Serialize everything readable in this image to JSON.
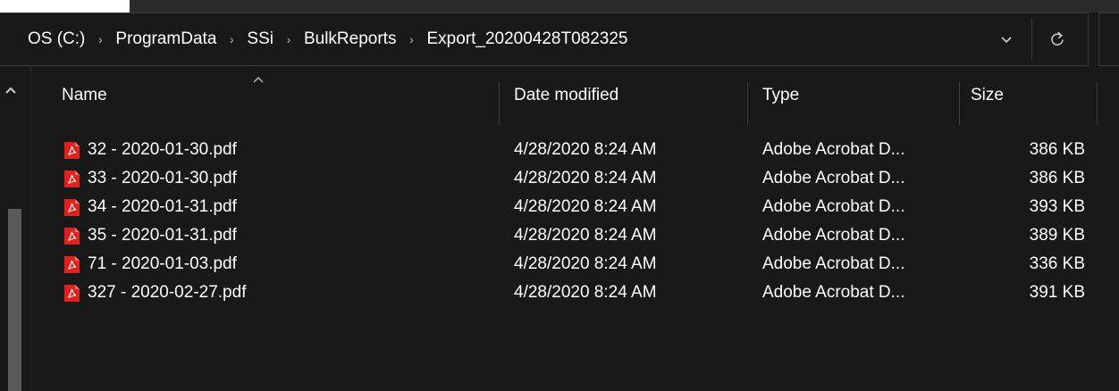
{
  "breadcrumb": {
    "items": [
      "OS (C:)",
      "ProgramData",
      "SSi",
      "BulkReports",
      "Export_20200428T082325"
    ]
  },
  "columns": {
    "name": "Name",
    "date": "Date modified",
    "type": "Type",
    "size": "Size"
  },
  "files": [
    {
      "name": "32 - 2020-01-30.pdf",
      "date": "4/28/2020 8:24 AM",
      "type": "Adobe Acrobat D...",
      "size": "386 KB"
    },
    {
      "name": "33 - 2020-01-30.pdf",
      "date": "4/28/2020 8:24 AM",
      "type": "Adobe Acrobat D...",
      "size": "386 KB"
    },
    {
      "name": "34 - 2020-01-31.pdf",
      "date": "4/28/2020 8:24 AM",
      "type": "Adobe Acrobat D...",
      "size": "393 KB"
    },
    {
      "name": "35 - 2020-01-31.pdf",
      "date": "4/28/2020 8:24 AM",
      "type": "Adobe Acrobat D...",
      "size": "389 KB"
    },
    {
      "name": "71 - 2020-01-03.pdf",
      "date": "4/28/2020 8:24 AM",
      "type": "Adobe Acrobat D...",
      "size": "336 KB"
    },
    {
      "name": "327 - 2020-02-27.pdf",
      "date": "4/28/2020 8:24 AM",
      "type": "Adobe Acrobat D...",
      "size": "391 KB"
    }
  ],
  "icons": {
    "file": "pdf-file-icon",
    "dropdown": "chevron-down-icon",
    "refresh": "refresh-icon",
    "sort": "sort-ascending-icon",
    "separator": "chevron-right-icon"
  },
  "colors": {
    "background": "#191919",
    "text": "#ffffff",
    "pdf_red": "#e0221e",
    "divider": "#3c3c3c"
  }
}
